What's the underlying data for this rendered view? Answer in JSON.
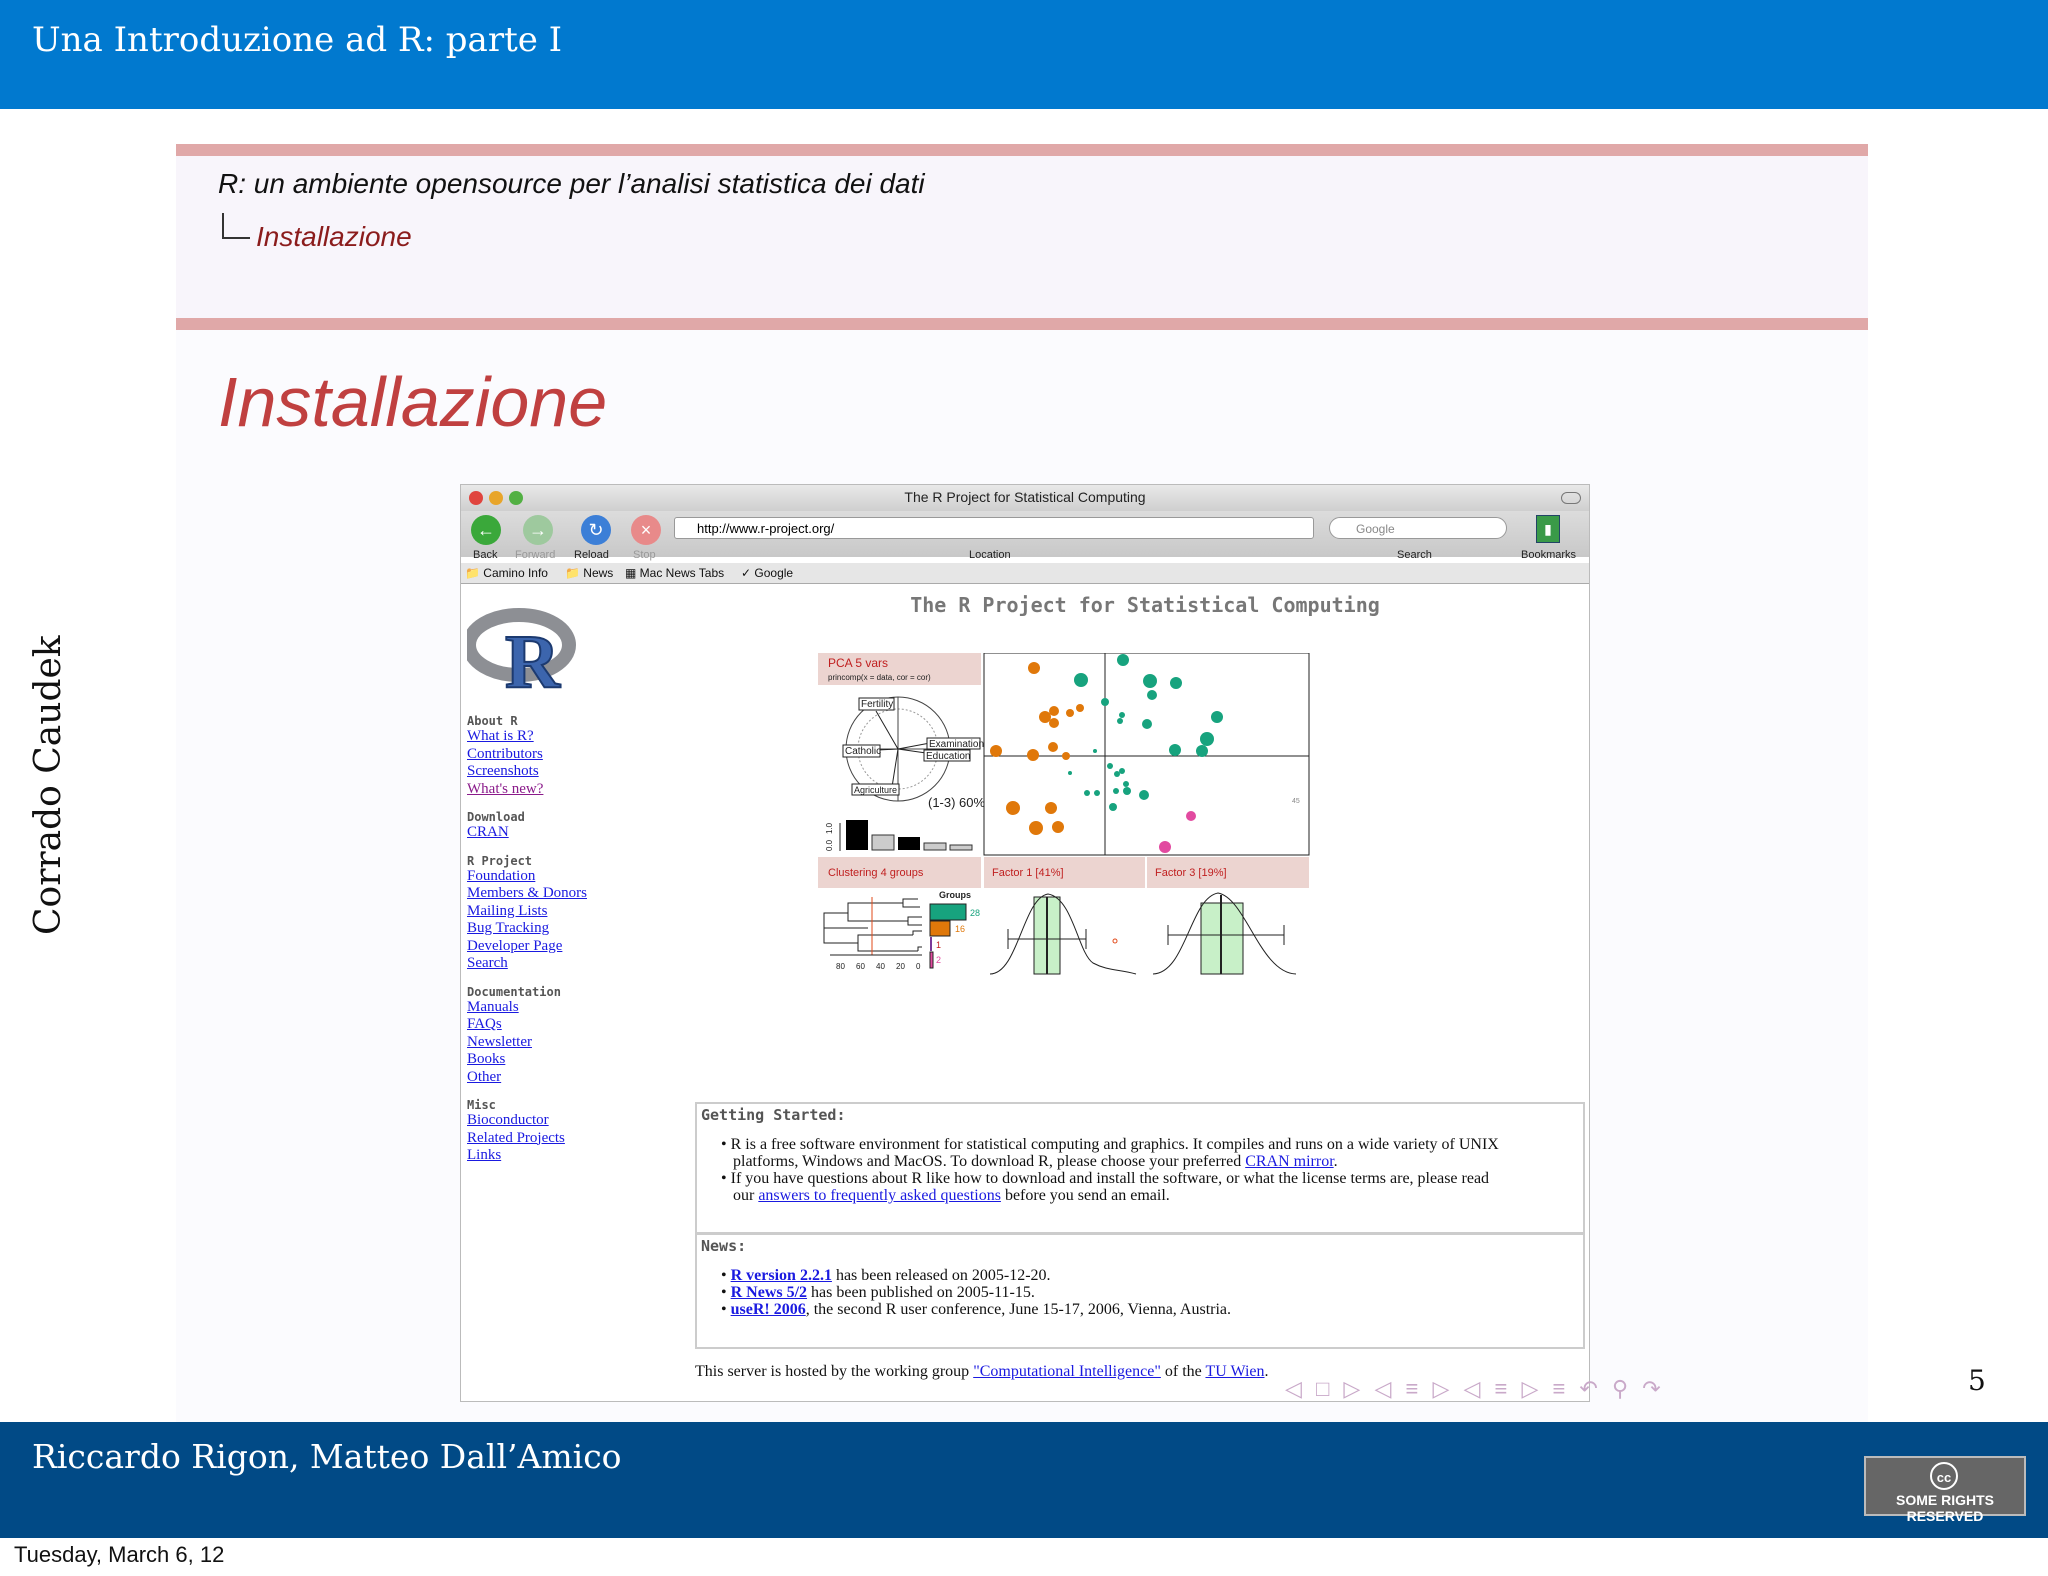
{
  "header": {
    "title": "Una Introduzione ad R: parte I"
  },
  "side_author": "Corrado Caudek",
  "breadcrumb": {
    "section": "R: un ambiente opensource per l’analisi statistica dei dati",
    "subsection": "Installazione"
  },
  "slide": {
    "title": "Installazione",
    "page_number": "5"
  },
  "browser": {
    "window_title": "The R Project for Statistical Computing",
    "toolbar": {
      "back": "Back",
      "forward": "Forward",
      "reload": "Reload",
      "stop": "Stop",
      "location": "Location",
      "search": "Search",
      "bookmarks": "Bookmarks"
    },
    "url": "http://www.r-project.org/",
    "search_placeholder": "Google",
    "bookmarks_bar": [
      "Camino Info",
      "News",
      "Mac News Tabs",
      "Google"
    ],
    "page_title": "The R Project for Statistical Computing",
    "nav": [
      {
        "heading": "About R",
        "links": [
          "What is R?",
          "Contributors",
          "Screenshots",
          "What's new?"
        ]
      },
      {
        "heading": "Download",
        "links": [
          "CRAN"
        ]
      },
      {
        "heading": "R Project",
        "links": [
          "Foundation",
          "Members & Donors",
          "Mailing Lists",
          "Bug Tracking",
          "Developer Page",
          "Search"
        ]
      },
      {
        "heading": "Documentation",
        "links": [
          "Manuals",
          "FAQs",
          "Newsletter",
          "Books",
          "Other"
        ]
      },
      {
        "heading": "Misc",
        "links": [
          "Bioconductor",
          "Related Projects",
          "Links"
        ]
      }
    ],
    "figure": {
      "pca_title": "PCA  5 vars",
      "pca_formula": "princomp(x = data, cor = cor)",
      "pca_labels": [
        "Fertility",
        "Catholic",
        "Examination",
        "Education",
        "Agriculture"
      ],
      "pca_variance": "(1-3) 60%",
      "scree_axis": [
        "0.0",
        "1.0"
      ],
      "cluster_title": "Clustering  4 groups",
      "factor1_title": "Factor 1 [41%]",
      "factor3_title": "Factor 3 [19%]",
      "groups_label": "Groups",
      "group_counts": [
        "28",
        "16",
        "1",
        "2"
      ],
      "dendro_axis": [
        "80",
        "60",
        "40",
        "20",
        "0"
      ],
      "scatter_note": "45",
      "colors": {
        "teal": "#17a37e",
        "orange": "#e0780a",
        "pink": "#e24aa0",
        "band": "#ecd4d0"
      }
    },
    "getting_started": {
      "title": "Getting Started:",
      "item1_a": "R is a free software environment for statistical computing and graphics. It compiles and runs on a wide variety of UNIX",
      "item1_b": "platforms, Windows and MacOS. To download R, please choose your preferred",
      "item1_link": "CRAN mirror",
      "item1_end": ".",
      "item2_a": "If you have questions about R like how to download and install the software, or what the license terms are, please read",
      "item2_b": "our",
      "item2_link": "answers to frequently asked questions",
      "item2_end": "before you send an email."
    },
    "news": {
      "title": "News:",
      "items": [
        {
          "link": "R version 2.2.1",
          "text": " has been released on 2005-12-20."
        },
        {
          "link": "R News 5/2",
          "text": " has been published on 2005-11-15."
        },
        {
          "link": "useR! 2006",
          "text": ", the second R user conference, June 15-17, 2006, Vienna, Austria."
        }
      ]
    },
    "footer": {
      "prefix": "This server is hosted by the working group ",
      "link1": "\"Computational Intelligence\"",
      "middle": " of the ",
      "link2": "TU Wien",
      "end": "."
    }
  },
  "footer": {
    "authors": "Riccardo Rigon, Matteo Dall’Amico",
    "date": "Tuesday, March 6, 12",
    "cc_badge": "SOME RIGHTS RESERVED",
    "cc_symbol": "cc"
  }
}
